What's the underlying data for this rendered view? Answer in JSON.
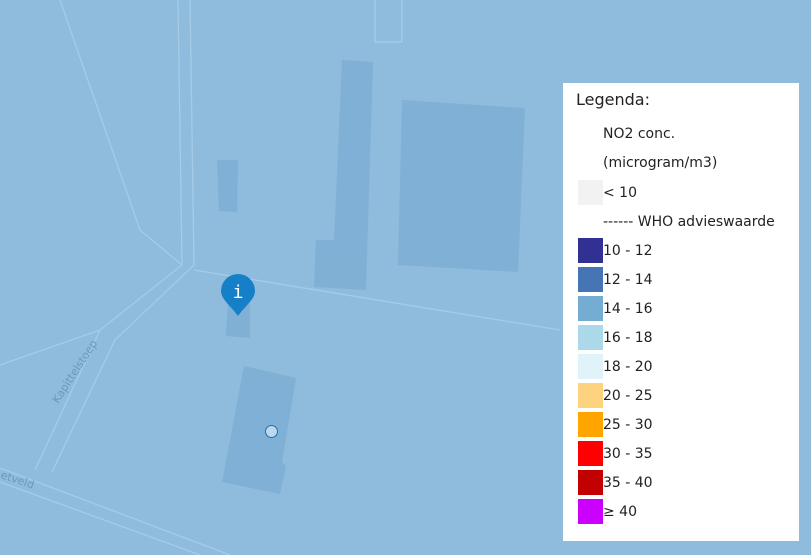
{
  "map": {
    "street_labels": [
      "Kapittelstoep",
      "etveld"
    ],
    "colors": {
      "background": "#8fbcdc",
      "building": "#7eaed3",
      "road_outline": "#a5cbe6"
    }
  },
  "markers": {
    "info_pin_glyph": "i",
    "info_pin_color": "#1580c8"
  },
  "legend": {
    "title": "Legenda:",
    "subtitle_line1": "NO2 conc.",
    "subtitle_line2": "(microgram/m3)",
    "items": [
      {
        "label": "< 10",
        "color": "#f2f2f2"
      },
      {
        "label": "------ WHO advieswaarde",
        "color": null
      },
      {
        "label": "10 - 12",
        "color": "#303193"
      },
      {
        "label": "12 - 14",
        "color": "#4575b4"
      },
      {
        "label": "14 - 16",
        "color": "#74add1"
      },
      {
        "label": "16 - 18",
        "color": "#abd9e9"
      },
      {
        "label": "18 - 20",
        "color": "#e0f3f8"
      },
      {
        "label": "20 - 25",
        "color": "#fed380"
      },
      {
        "label": "25 - 30",
        "color": "#ffa500"
      },
      {
        "label": "30 - 35",
        "color": "#ff0000"
      },
      {
        "label": "35 - 40",
        "color": "#c20000"
      },
      {
        "label": "≥ 40",
        "color": "#cc00ff"
      }
    ]
  }
}
